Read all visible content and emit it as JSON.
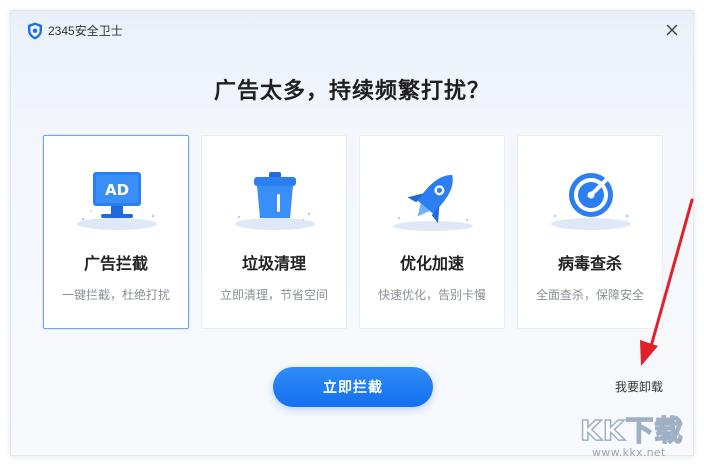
{
  "window": {
    "title": "2345安全卫士",
    "close_symbol": "✕"
  },
  "main": {
    "headline": "广告太多，持续频繁打扰？",
    "cards": [
      {
        "title": "广告拦截",
        "desc": "一键拦截，杜绝打扰",
        "icon": "ad-monitor-icon",
        "icon_text": "AD",
        "selected": true
      },
      {
        "title": "垃圾清理",
        "desc": "立即清理，节省空间",
        "icon": "trash-can-icon",
        "selected": false
      },
      {
        "title": "优化加速",
        "desc": "快速优化，告别卡慢",
        "icon": "rocket-icon",
        "selected": false
      },
      {
        "title": "病毒查杀",
        "desc": "全面查杀，保障安全",
        "icon": "target-scan-icon",
        "selected": false
      }
    ],
    "primary_button": "立即拦截",
    "uninstall_link": "我要卸载"
  },
  "watermark": {
    "logo_text": "KK下载",
    "url": "www.kkx.net"
  },
  "colors": {
    "accent": "#1677f0",
    "arrow": "#e0202a"
  }
}
